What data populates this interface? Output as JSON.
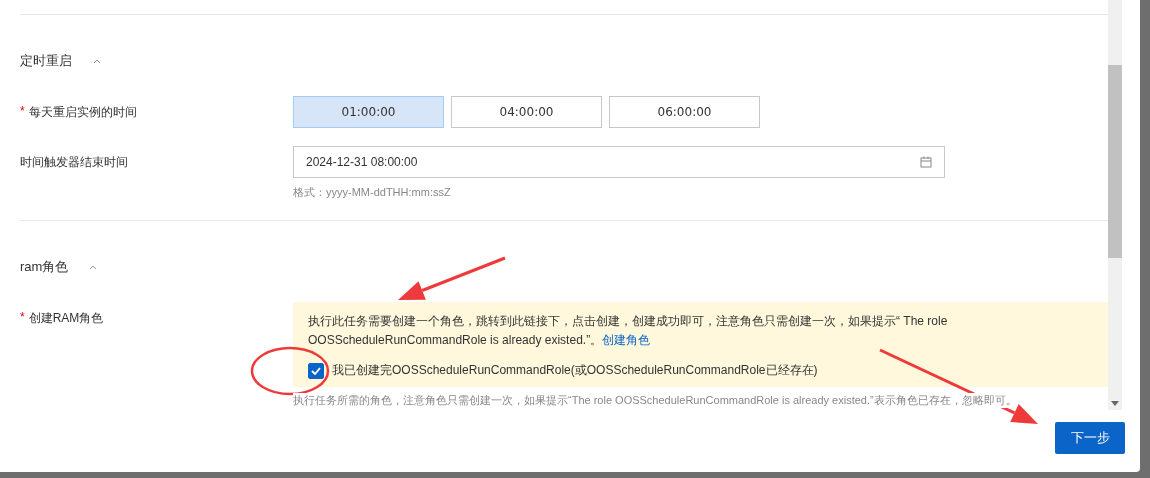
{
  "sections": [
    {
      "title": "定时重启",
      "expanded": true,
      "rows": [
        {
          "kind": "choice",
          "label": "每天重启实例的时间",
          "required_mark": "*",
          "options": [
            {
              "label": "01:00:00",
              "selected": true
            },
            {
              "label": "04:00:00",
              "selected": false
            },
            {
              "label": "06:00:00",
              "selected": false
            }
          ]
        },
        {
          "kind": "date",
          "label": "时间触发器结束时间",
          "value": "2024-12-31 08:00:00",
          "hint": "格式：yyyy-MM-ddTHH:mm:ssZ"
        }
      ]
    },
    {
      "title": "ram角色",
      "expanded": true,
      "rows": [
        {
          "kind": "alert",
          "label": "创建RAM角色",
          "required_mark": "*",
          "message": "执行此任务需要创建一个角色，跳转到此链接下，点击创建，创建成功即可，注意角色只需创建一次，如果提示“ The role OOSScheduleRunCommandRole is already existed.”。",
          "link": "创建角色",
          "checkbox": {
            "label": "我已创建完OOSScheduleRunCommandRole(或OOSScheduleRunCommandRole已经存在)",
            "checked": true
          },
          "hint": "执行任务所需的角色，注意角色只需创建一次，如果提示“The role OOSScheduleRunCommandRole is already existed.”表示角色已存在，忽略即可。"
        }
      ]
    }
  ],
  "footer": {
    "next_button": "下一步"
  },
  "annotations": [
    {
      "kind": "ellipse"
    },
    {
      "kind": "arrow"
    },
    {
      "kind": "arrow"
    }
  ]
}
